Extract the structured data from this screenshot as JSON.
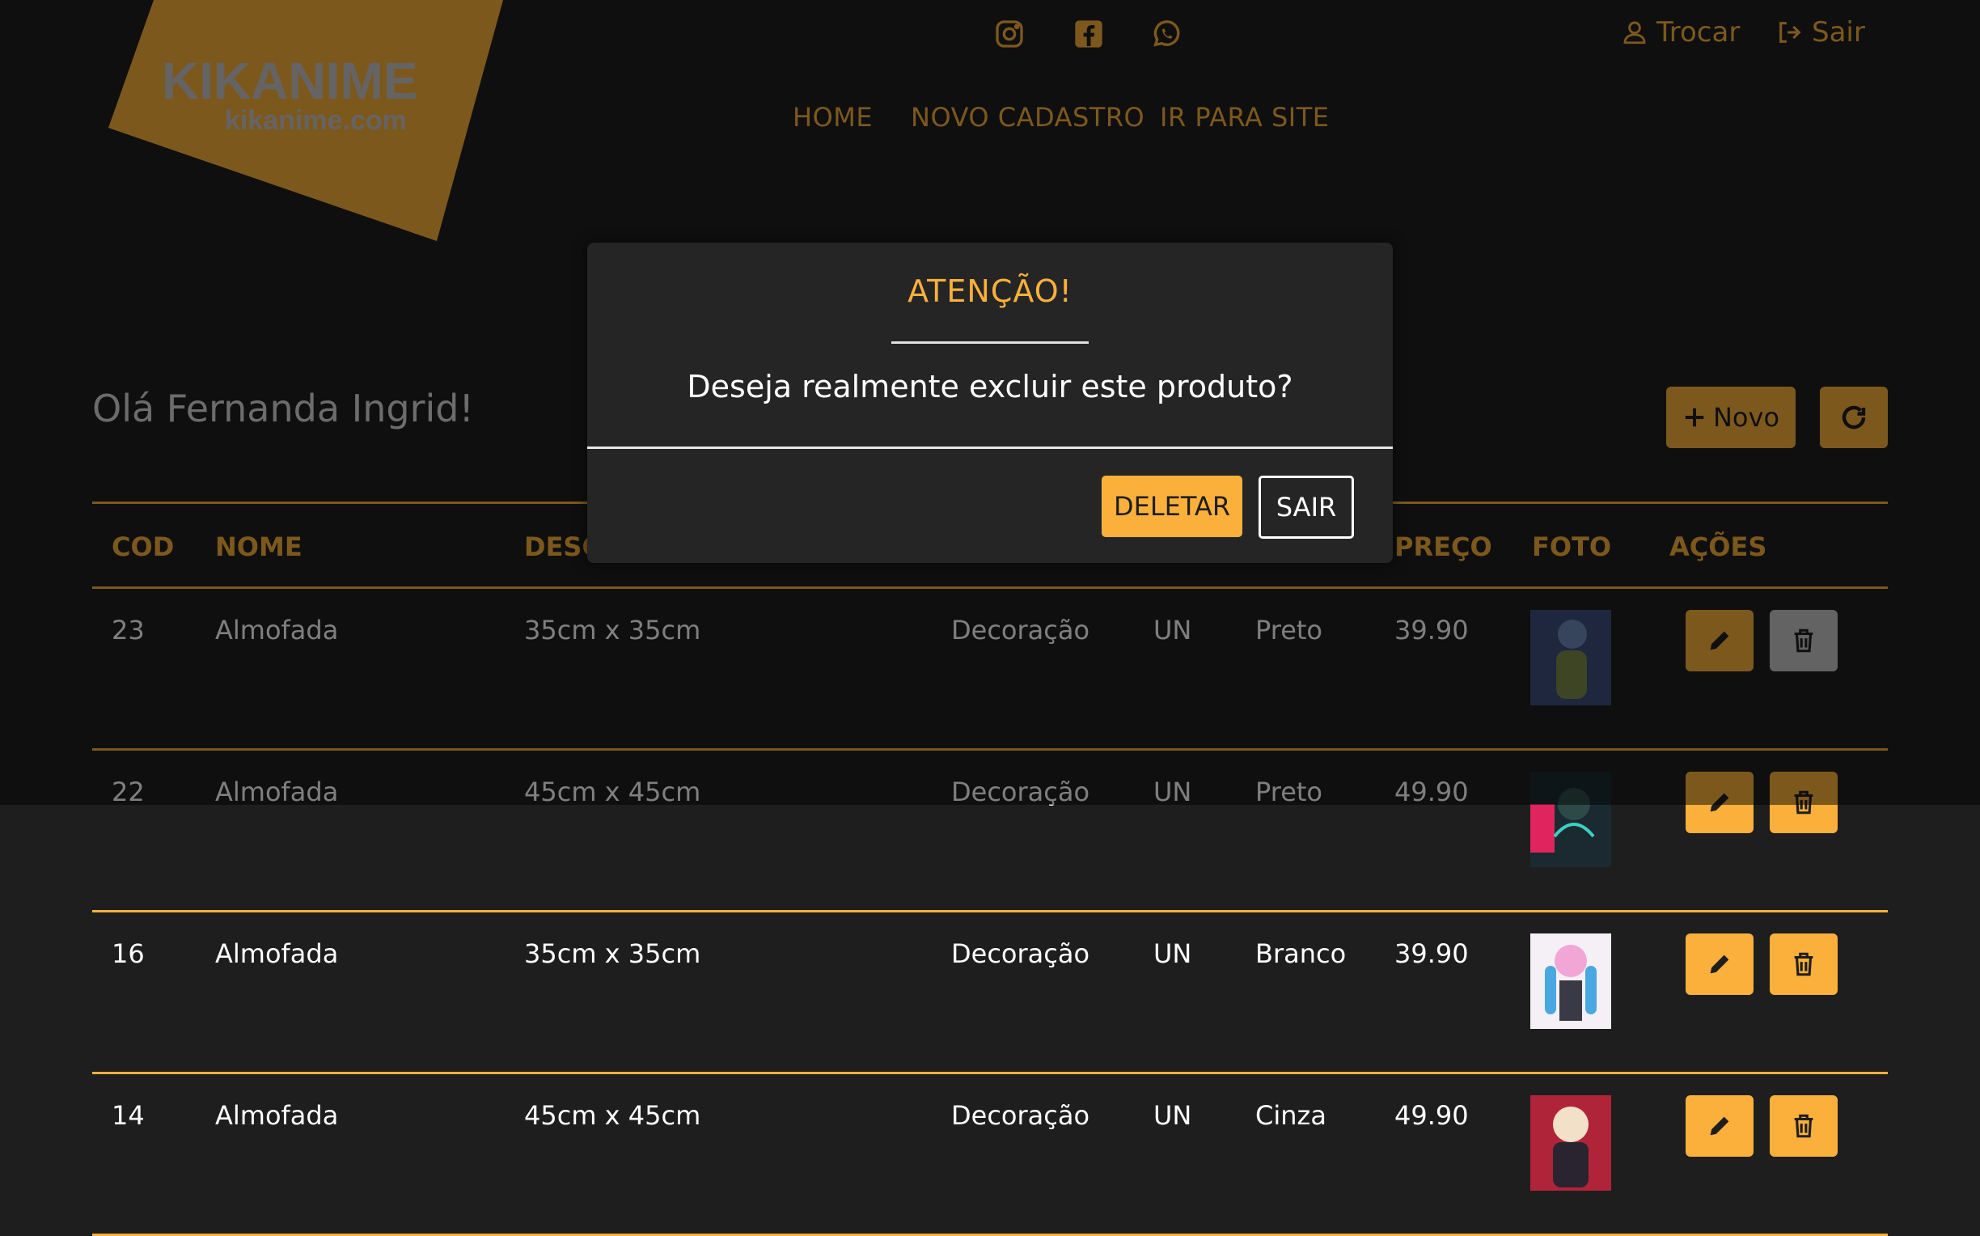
{
  "brand": {
    "name": "KIKANIME",
    "domain": "kikanime.com",
    "color": "#fbb03b"
  },
  "header": {
    "social": [
      "instagram-icon",
      "facebook-icon",
      "whatsapp-icon"
    ],
    "trocar": "Trocar",
    "sair": "Sair",
    "nav": [
      "HOME",
      "NOVO CADASTRO",
      "IR PARA SITE"
    ]
  },
  "greeting": "Olá Fernanda Ingrid!",
  "toolbar": {
    "novo": "Novo"
  },
  "table": {
    "headers": [
      "COD",
      "NOME",
      "DESC",
      "PREÇO",
      "FOTO",
      "AÇÕES"
    ],
    "rows": [
      {
        "cod": "23",
        "nome": "Almofada",
        "desc": "35cm x 35cm",
        "cat": "Decoração",
        "un": "UN",
        "cor": "Preto",
        "preco": "39.90"
      },
      {
        "cod": "22",
        "nome": "Almofada",
        "desc": "45cm x 45cm",
        "cat": "Decoração",
        "un": "UN",
        "cor": "Preto",
        "preco": "49.90"
      },
      {
        "cod": "16",
        "nome": "Almofada",
        "desc": "35cm x 35cm",
        "cat": "Decoração",
        "un": "UN",
        "cor": "Branco",
        "preco": "39.90"
      },
      {
        "cod": "14",
        "nome": "Almofada",
        "desc": "45cm x 45cm",
        "cat": "Decoração",
        "un": "UN",
        "cor": "Cinza",
        "preco": "49.90"
      }
    ]
  },
  "modal": {
    "title": "ATENÇÃO!",
    "message": "Deseja realmente excluir este produto?",
    "confirm": "DELETAR",
    "cancel": "SAIR"
  }
}
